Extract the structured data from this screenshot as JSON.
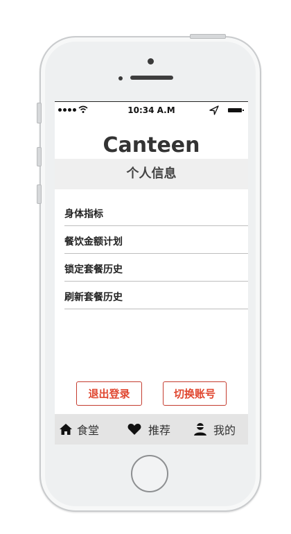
{
  "status_bar": {
    "time": "10:34 A.M"
  },
  "app": {
    "title": "Canteen"
  },
  "section": {
    "title": "个人信息"
  },
  "menu": {
    "items": [
      {
        "label": "身体指标"
      },
      {
        "label": "餐饮金额计划"
      },
      {
        "label": "锁定套餐历史"
      },
      {
        "label": "刷新套餐历史"
      }
    ]
  },
  "actions": {
    "logout_label": "退出登录",
    "switch_label": "切换账号"
  },
  "tabbar": {
    "items": [
      {
        "label": "食堂",
        "icon": "home-icon"
      },
      {
        "label": "推荐",
        "icon": "heart-icon"
      },
      {
        "label": "我的",
        "icon": "user-icon"
      }
    ]
  },
  "colors": {
    "accent": "#e0462f",
    "section_bg": "#efefef",
    "tabbar_bg": "#e4e4e4"
  }
}
